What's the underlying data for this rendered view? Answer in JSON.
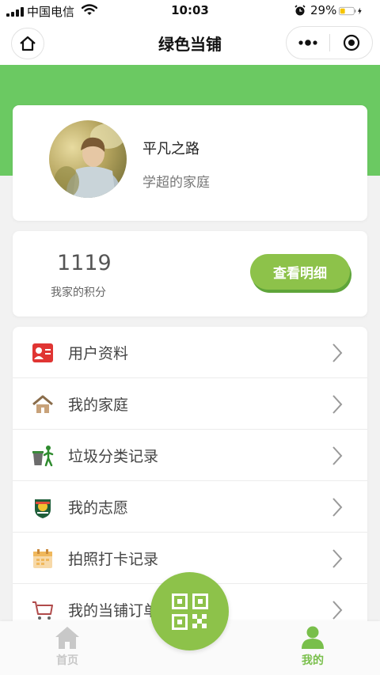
{
  "status_bar": {
    "carrier": "中国电信",
    "time": "10:03",
    "battery": "29%"
  },
  "nav": {
    "title": "绿色当铺"
  },
  "profile": {
    "name": "平凡之路",
    "family": "学超的家庭"
  },
  "points": {
    "value": "1119",
    "label": "我家的积分",
    "detail_button": "查看明细"
  },
  "menu": {
    "items": [
      {
        "label": "用户资料",
        "icon": "user-card-icon"
      },
      {
        "label": "我的家庭",
        "icon": "house-icon"
      },
      {
        "label": "垃圾分类记录",
        "icon": "trash-sort-icon"
      },
      {
        "label": "我的志愿",
        "icon": "volunteer-badge-icon"
      },
      {
        "label": "拍照打卡记录",
        "icon": "calendar-icon"
      },
      {
        "label": "我的当铺订单",
        "icon": "shopping-cart-icon"
      }
    ]
  },
  "tabs": {
    "home": {
      "label": "首页",
      "active": false
    },
    "mine": {
      "label": "我的",
      "active": true
    }
  },
  "colors": {
    "brand_green": "#6bc962",
    "button_green": "#8dc24a",
    "tab_inactive": "#c8c8c8"
  }
}
